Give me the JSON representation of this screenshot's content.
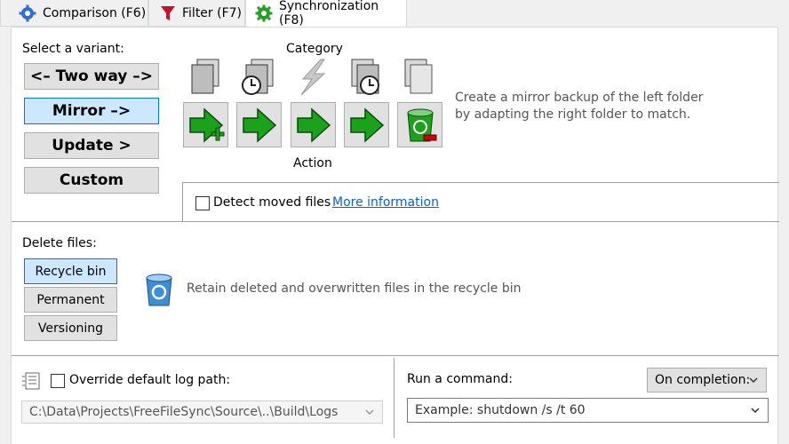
{
  "tabs": [
    {
      "label": "Comparison (F6)",
      "icon": "gear-icon"
    },
    {
      "label": "Filter (F7)",
      "icon": "funnel-icon"
    },
    {
      "label": "Synchronization (F8)",
      "icon": "gear-green-icon",
      "active": true
    }
  ],
  "variant": {
    "title": "Select a variant:",
    "buttons": [
      "<– Two way –>",
      "Mirror –>",
      "Update >",
      "Custom"
    ],
    "selected": "Mirror –>"
  },
  "category_label": "Category",
  "action_label": "Action",
  "description": "Create a mirror backup of the left folder by adapting the right folder to match.",
  "detect_moved": {
    "label": "Detect moved files",
    "checked": false,
    "link": "More information"
  },
  "delete": {
    "title": "Delete files:",
    "buttons": [
      "Recycle bin",
      "Permanent",
      "Versioning"
    ],
    "selected": "Recycle bin",
    "description": "Retain deleted and overwritten files in the recycle bin"
  },
  "log": {
    "override_label": "Override default log path:",
    "checked": false,
    "path": "C:\\Data\\Projects\\FreeFileSync\\Source\\..\\Build\\Logs"
  },
  "command": {
    "label": "Run a command:",
    "when": "On completion:",
    "placeholder": "Example: shutdown /s /t 60"
  },
  "colors": {
    "selected_bg": "#cce8ff",
    "selected_border": "#0078d7",
    "button_bg": "#e1e1e1",
    "link": "#0066cc",
    "arrow_green": "#1aa31a"
  }
}
